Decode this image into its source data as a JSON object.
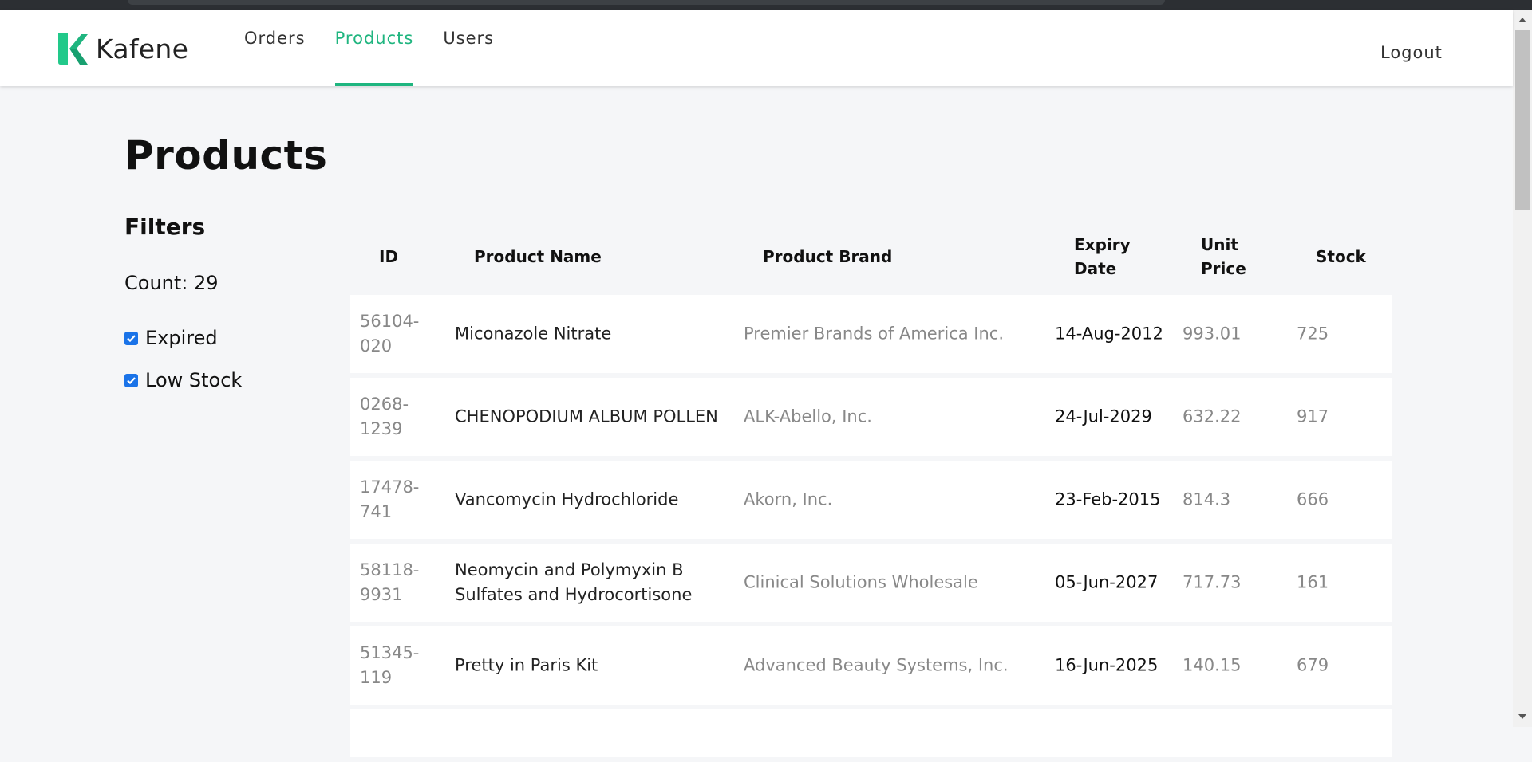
{
  "header": {
    "brand": "Kafene",
    "nav": [
      {
        "label": "Orders",
        "active": false
      },
      {
        "label": "Products",
        "active": true
      },
      {
        "label": "Users",
        "active": false
      }
    ],
    "logout_label": "Logout",
    "accent_color": "#1fb57f"
  },
  "page": {
    "title": "Products"
  },
  "filters": {
    "title": "Filters",
    "count_text": "Count: 29",
    "options": [
      {
        "label": "Expired",
        "checked": true
      },
      {
        "label": "Low Stock",
        "checked": true
      }
    ]
  },
  "table": {
    "columns": [
      "ID",
      "Product Name",
      "Product Brand",
      "Expiry Date",
      "Unit Price",
      "Stock"
    ],
    "rows": [
      {
        "id": "56104-020",
        "name": "Miconazole Nitrate",
        "brand": "Premier Brands of America Inc.",
        "expiry": "14-Aug-2012",
        "price": "993.01",
        "stock": "725"
      },
      {
        "id": "0268-1239",
        "name": "CHENOPODIUM ALBUM POLLEN",
        "brand": "ALK-Abello, Inc.",
        "expiry": "24-Jul-2029",
        "price": "632.22",
        "stock": "917"
      },
      {
        "id": "17478-741",
        "name": "Vancomycin Hydrochloride",
        "brand": "Akorn, Inc.",
        "expiry": "23-Feb-2015",
        "price": "814.3",
        "stock": "666"
      },
      {
        "id": "58118-9931",
        "name": "Neomycin and Polymyxin B Sulfates and Hydrocortisone",
        "brand": "Clinical Solutions Wholesale",
        "expiry": "05-Jun-2027",
        "price": "717.73",
        "stock": "161"
      },
      {
        "id": "51345-119",
        "name": "Pretty in Paris Kit",
        "brand": "Advanced Beauty Systems, Inc.",
        "expiry": "16-Jun-2025",
        "price": "140.15",
        "stock": "679"
      }
    ]
  }
}
